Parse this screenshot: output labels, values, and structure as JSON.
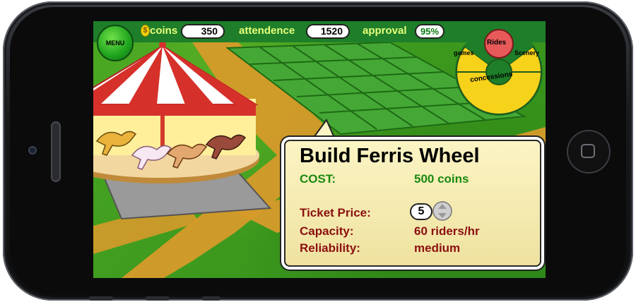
{
  "hud": {
    "menu_label": "MENU",
    "coin_symbol": "$",
    "coins_label": "coins",
    "coins_value": "350",
    "attendence_label": "attendence",
    "attendence_value": "1520",
    "approval_label": "approval",
    "approval_value": "95%"
  },
  "build_menu": {
    "center_label": "Rides",
    "left_label": "games",
    "right_label": "Scenery",
    "bottom_label": "concessions"
  },
  "popup": {
    "title": "Build Ferris Wheel",
    "cost_label": "COST:",
    "cost_value": "500 coins",
    "ticket_price_label": "Ticket Price:",
    "ticket_price_value": "5",
    "capacity_label": "Capacity:",
    "capacity_value": "60 riders/hr",
    "reliability_label": "Reliability:",
    "reliability_value": "medium"
  },
  "colors": {
    "hud_bg": "#1e7e2a",
    "hud_text": "#e6ff7a",
    "popup_bg": "#fbf4c4",
    "cost_green": "#1a8a10",
    "stat_red": "#8b1010",
    "menu_ring": "#f6d21a",
    "rides_button": "#e85a5a"
  }
}
